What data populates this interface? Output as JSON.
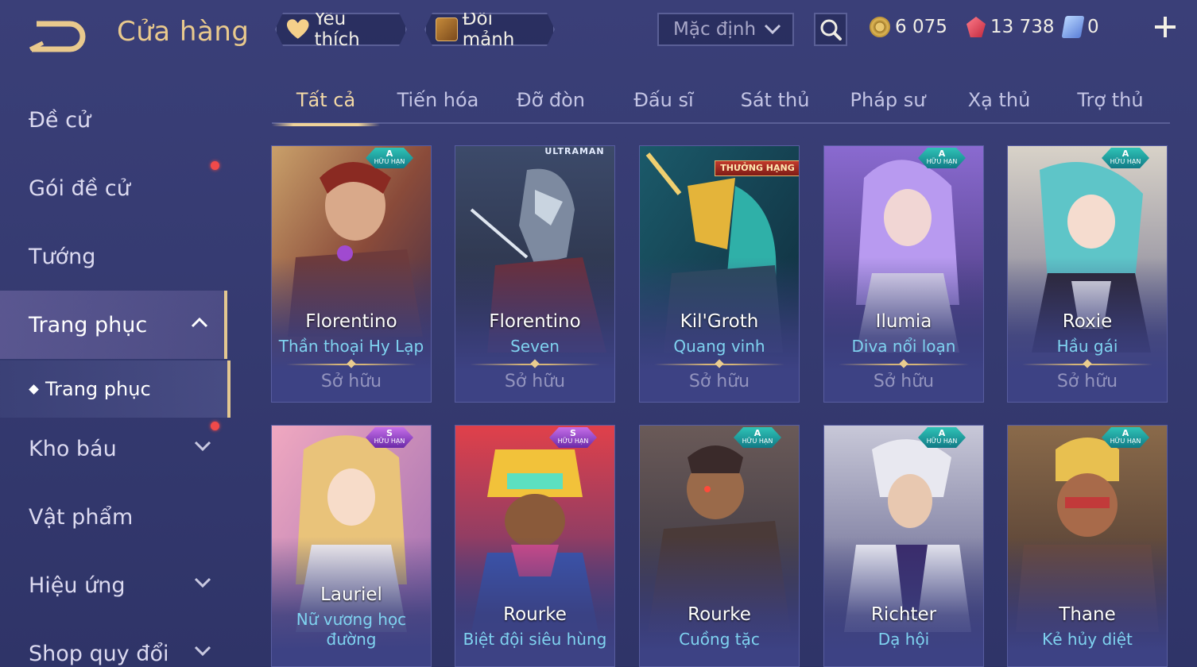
{
  "header": {
    "back_icon": "back-arrow-icon",
    "title": "Cửa hàng",
    "favorites_label": "Yêu thích",
    "shard_exchange_label": "Đổi mảnh",
    "sort_value": "Mặc định",
    "currencies": {
      "gold": "6 075",
      "ruby": "13 738",
      "voucher": "0"
    }
  },
  "sidebar": {
    "items": [
      {
        "label": "Đề cử"
      },
      {
        "label": "Gói đề cử"
      },
      {
        "label": "Tướng"
      },
      {
        "label": "Trang phục"
      },
      {
        "label": "Kho báu"
      },
      {
        "label": "Vật phẩm"
      },
      {
        "label": "Hiệu ứng"
      },
      {
        "label": "Shop quy đổi"
      }
    ],
    "sub_item": "Trang phục"
  },
  "tabs": [
    "Tất cả",
    "Tiến hóa",
    "Đỡ đòn",
    "Đấu sĩ",
    "Sát thủ",
    "Pháp sư",
    "Xạ thủ",
    "Trợ thủ"
  ],
  "cards": [
    {
      "hero": "Florentino",
      "skin": "Thần thoại Hy Lạp",
      "status": "Sở hữu",
      "tier": "A",
      "tier_note": "HỮU HẠN"
    },
    {
      "hero": "Florentino",
      "skin": "Seven",
      "status": "Sở hữu",
      "brand": "ULTRAMAN"
    },
    {
      "hero": "Kil'Groth",
      "skin": "Quang vinh",
      "status": "Sở hữu",
      "ribbon": "THƯỞNG HẠNG"
    },
    {
      "hero": "Ilumia",
      "skin": "Diva nổi loạn",
      "status": "Sở hữu",
      "tier": "A",
      "tier_note": "HỮU HẠN"
    },
    {
      "hero": "Roxie",
      "skin": "Hầu gái",
      "status": "Sở hữu",
      "tier": "A",
      "tier_note": "HỮU HẠN"
    },
    {
      "hero": "Lauriel",
      "skin_line1": "Nữ vương học",
      "skin_line2": "đường",
      "tier": "S",
      "tier_note": "HỮU HẠN"
    },
    {
      "hero": "Rourke",
      "skin": "Biệt đội siêu hùng",
      "tier": "S",
      "tier_note": "HỮU HẠN"
    },
    {
      "hero": "Rourke",
      "skin": "Cuồng tặc",
      "tier": "A",
      "tier_note": "HỮU HẠN"
    },
    {
      "hero": "Richter",
      "skin": "Dạ hội",
      "tier": "A",
      "tier_note": "HỮU HẠN"
    },
    {
      "hero": "Thane",
      "skin": "Kẻ hủy diệt",
      "tier": "A",
      "tier_note": "HỮU HẠN"
    }
  ],
  "colors": {
    "accent_gold": "#e9c98d",
    "skin_name": "#7fd3f0",
    "background": "#3a3f78"
  }
}
